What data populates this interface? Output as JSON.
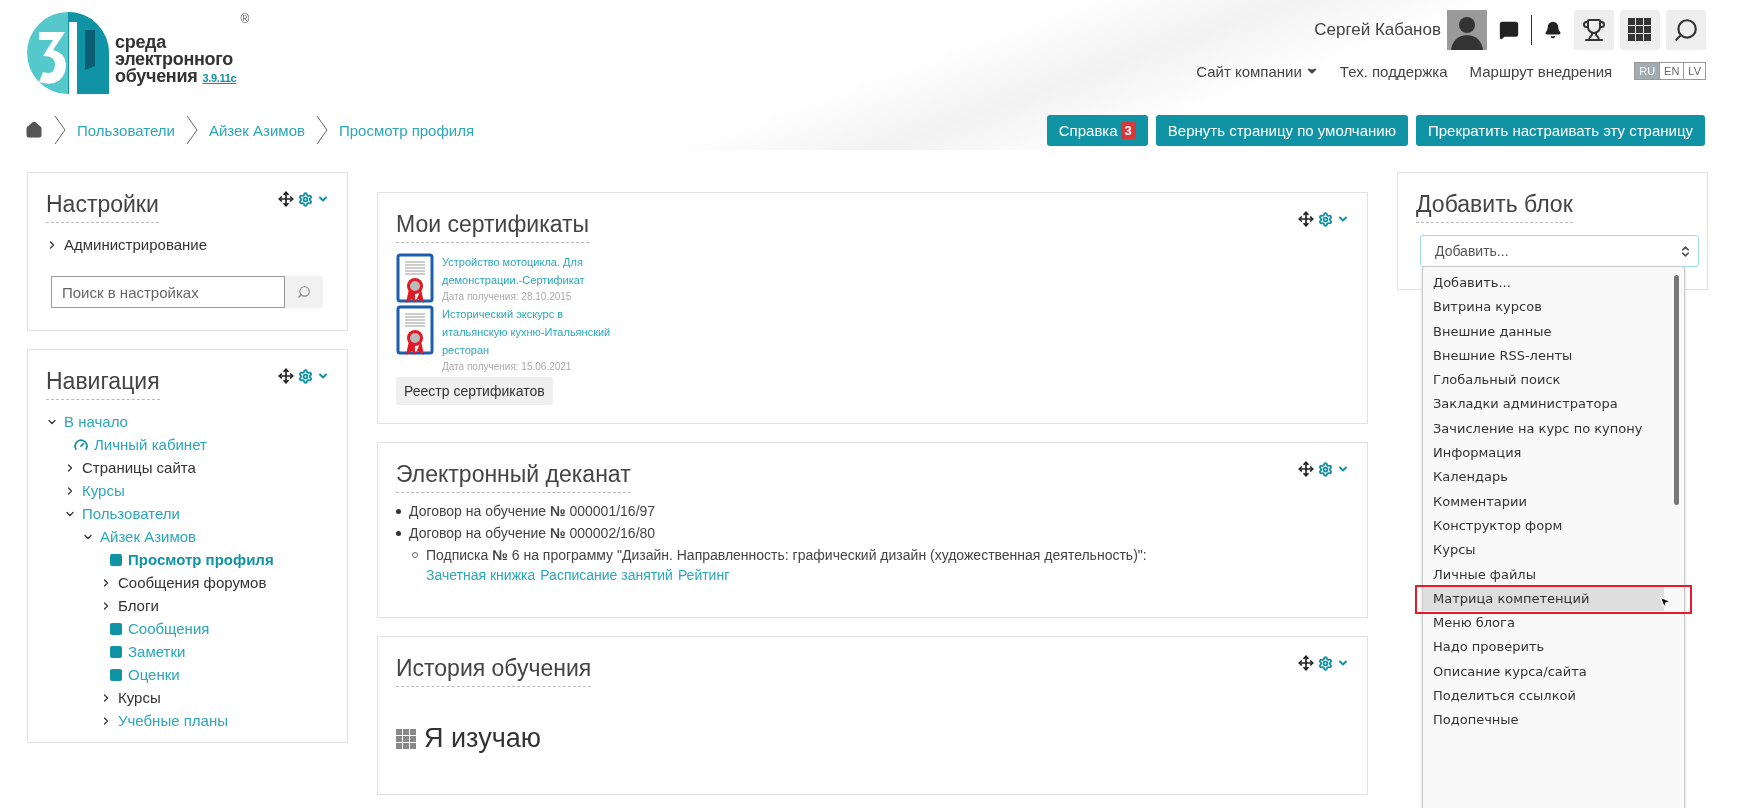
{
  "header": {
    "logo": {
      "line_1": "среда",
      "line_2": "электронного",
      "line_3": "обучения",
      "version": "3.9.11c",
      "mark": "®"
    },
    "user": {
      "name": "Сергей Кабанов"
    },
    "links": [
      {
        "label": "Сайт компании",
        "dropdown": true
      },
      {
        "label": "Тех. поддержка",
        "dropdown": false
      },
      {
        "label": "Маршрут внедрения",
        "dropdown": false
      }
    ],
    "languages": [
      {
        "label": "RU",
        "selected": true
      },
      {
        "label": "EN",
        "selected": false
      },
      {
        "label": "LV",
        "selected": false
      }
    ]
  },
  "breadcrumb": [
    "Пользователи",
    "Айзек Азимов",
    "Просмотр профиля"
  ],
  "actions": [
    {
      "label": "Справка",
      "badge": "3"
    },
    {
      "label": "Вернуть страницу по умолчанию"
    },
    {
      "label": "Прекратить настраивать эту страницу"
    }
  ],
  "settings_block": {
    "title": "Настройки",
    "items": [
      {
        "label": "Администрирование"
      }
    ],
    "search": {
      "placeholder": "Поиск в настройках"
    }
  },
  "navigation_block": {
    "title": "Навигация",
    "items": [
      {
        "label": "В начало",
        "kind": "branch",
        "expanded": true,
        "link": true,
        "selected": false,
        "children": [
          {
            "label": "Личный кабинет",
            "kind": "dashboard",
            "link": true,
            "selected": false
          },
          {
            "label": "Страницы сайта",
            "kind": "branch",
            "expanded": false,
            "link": false,
            "selected": false
          },
          {
            "label": "Курсы",
            "kind": "branch",
            "expanded": false,
            "link": true,
            "selected": false
          },
          {
            "label": "Пользователи",
            "kind": "branch",
            "expanded": true,
            "link": true,
            "selected": false,
            "children": [
              {
                "label": "Айзек Азимов",
                "kind": "branch",
                "expanded": true,
                "link": true,
                "selected": false,
                "children": [
                  {
                    "label": "Просмотр профиля",
                    "kind": "leaf",
                    "link": true,
                    "selected": true
                  },
                  {
                    "label": "Сообщения форумов",
                    "kind": "branch",
                    "expanded": false,
                    "link": false,
                    "selected": false
                  },
                  {
                    "label": "Блоги",
                    "kind": "branch",
                    "expanded": false,
                    "link": false,
                    "selected": false
                  },
                  {
                    "label": "Сообщения",
                    "kind": "leaf",
                    "link": true,
                    "selected": false
                  },
                  {
                    "label": "Заметки",
                    "kind": "leaf",
                    "link": true,
                    "selected": false
                  },
                  {
                    "label": "Оценки",
                    "kind": "leaf",
                    "link": true,
                    "selected": false
                  },
                  {
                    "label": "Курсы",
                    "kind": "branch",
                    "expanded": false,
                    "link": false,
                    "selected": false
                  },
                  {
                    "label": "Учебные планы",
                    "kind": "branch",
                    "expanded": false,
                    "link": true,
                    "selected": false
                  }
                ]
              }
            ]
          }
        ]
      }
    ]
  },
  "certificates_block": {
    "title": "Мои сертификаты",
    "certificates": [
      {
        "name": "Устройство мотоцикла. Для демонстрации.-Сертификат",
        "date": "Дата получения: 28.10.2015"
      },
      {
        "name": "Исторический экскурс в итальянскую кухню-Итальянский ресторан",
        "date": "Дата получения: 15.06.2021"
      }
    ],
    "button": "Реестр сертификатов"
  },
  "deanery_block": {
    "title": "Электронный деканат",
    "contracts": [
      {
        "text": "Договор на обучение **№** 000001/16/97"
      },
      {
        "text": "Договор на обучение **№** 000002/16/80",
        "subscriptions": [
          {
            "text": "Подписка **№** 6 на программу \"Дизайн. Направленность: графический дизайн (художественная деятельность)\":",
            "links": [
              "Зачетная книжка",
              "Расписание занятий",
              "Рейтинг"
            ]
          }
        ]
      }
    ]
  },
  "history_block": {
    "title": "История обучения",
    "section": "Я изучаю"
  },
  "add_block": {
    "title": "Добавить блок",
    "select": {
      "value": "Добавить..."
    },
    "options": [
      {
        "label": "Добавить...",
        "selected": false
      },
      {
        "label": "Витрина курсов",
        "selected": false
      },
      {
        "label": "Внешние данные",
        "selected": false
      },
      {
        "label": "Внешние RSS-ленты",
        "selected": false
      },
      {
        "label": "Глобальный поиск",
        "selected": false
      },
      {
        "label": "Закладки администратора",
        "selected": false
      },
      {
        "label": "Зачисление на курс по купону",
        "selected": false
      },
      {
        "label": "Информация",
        "selected": false
      },
      {
        "label": "Календарь",
        "selected": false
      },
      {
        "label": "Комментарии",
        "selected": false
      },
      {
        "label": "Конструктор форм",
        "selected": false
      },
      {
        "label": "Курсы",
        "selected": false
      },
      {
        "label": "Личные файлы",
        "selected": false
      },
      {
        "label": "Матрица компетенций",
        "selected": true
      },
      {
        "label": "Меню блога",
        "selected": false
      },
      {
        "label": "Надо проверить",
        "selected": false
      },
      {
        "label": "Описание курса/сайта",
        "selected": false
      },
      {
        "label": "Поделиться ссылкой",
        "selected": false
      },
      {
        "label": "Подопечные",
        "selected": false
      }
    ]
  }
}
